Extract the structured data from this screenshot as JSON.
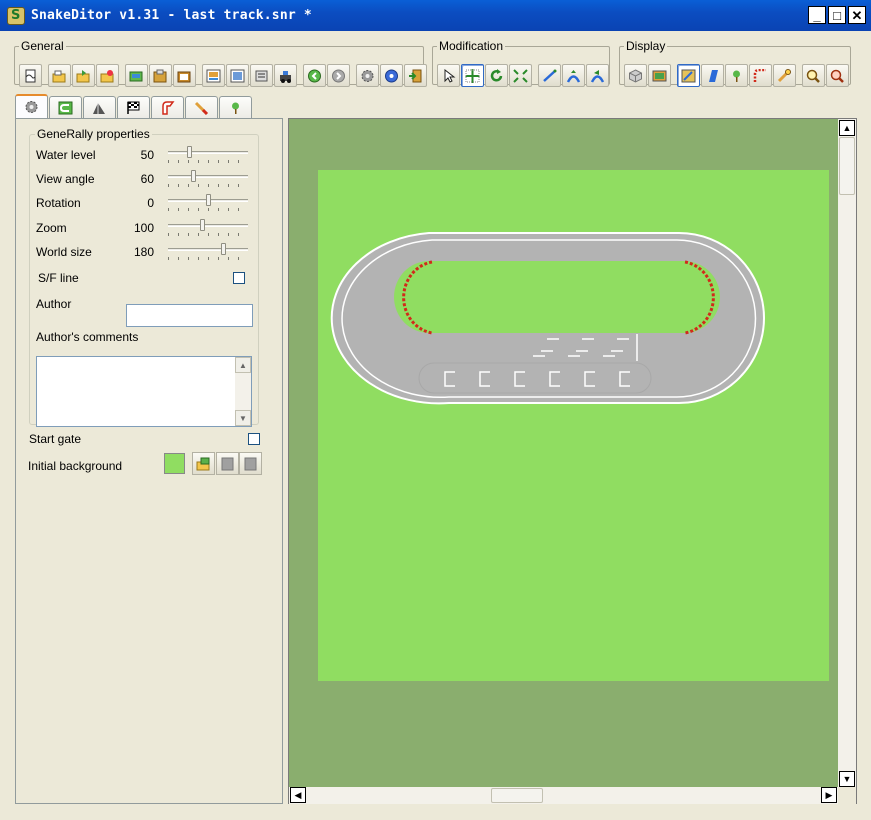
{
  "window": {
    "title": "SnakeDitor v1.31 - last track.snr *",
    "controls": {
      "minimize": "_",
      "maximize": "□",
      "close": "✕"
    }
  },
  "toolbar": {
    "groups": [
      {
        "label": "General",
        "buttons": [
          "new-track-icon",
          "open-icon",
          "open-recent-icon",
          "import-icon",
          "copy-layer-icon",
          "paste-icon",
          "clipboard-icon",
          "export-image-icon",
          "export-bitmap-icon",
          "track-list-icon",
          "test-run-icon",
          "undo-icon",
          "redo-icon",
          "settings-icon",
          "help-icon",
          "exit-icon"
        ]
      },
      {
        "label": "Modification",
        "buttons": [
          "select-icon",
          "move-icon",
          "rotate-icon",
          "scale-icon",
          "draw-line-icon",
          "raise-icon",
          "lower-icon"
        ]
      },
      {
        "label": "Display",
        "buttons": [
          "3d-view-icon",
          "background-icon",
          "texture-icon",
          "height-icon",
          "objects-icon",
          "path-icon",
          "tools-icon",
          "zoom-in-icon",
          "zoom-out-icon"
        ]
      }
    ]
  },
  "tabs": [
    "settings",
    "track",
    "heights",
    "start",
    "path",
    "paint",
    "objects"
  ],
  "properties": {
    "group_label": "GeneRally properties",
    "rows": [
      {
        "label": "Water level",
        "value": "50",
        "level": 0.25
      },
      {
        "label": "View angle",
        "value": "60",
        "level": 0.3
      },
      {
        "label": "Rotation",
        "value": "0",
        "level": 0.5
      },
      {
        "label": "Zoom",
        "value": "100",
        "level": 0.42
      },
      {
        "label": "World size",
        "value": "180",
        "level": 0.7
      }
    ],
    "sf_line_label": "S/F line",
    "sf_line_checked": false,
    "author_label": "Author",
    "author_value": "",
    "comments_label": "Author's comments",
    "comments_value": ""
  },
  "start_gate_label": "Start gate",
  "start_gate_checked": false,
  "initial_background_label": "Initial background",
  "initial_background_color": "#90dd61",
  "canvas": {
    "outer_color": "#8aae6e",
    "field_color": "#90dd61",
    "track_color": "#b3b3b3",
    "curb_color": "#d12a1a"
  }
}
